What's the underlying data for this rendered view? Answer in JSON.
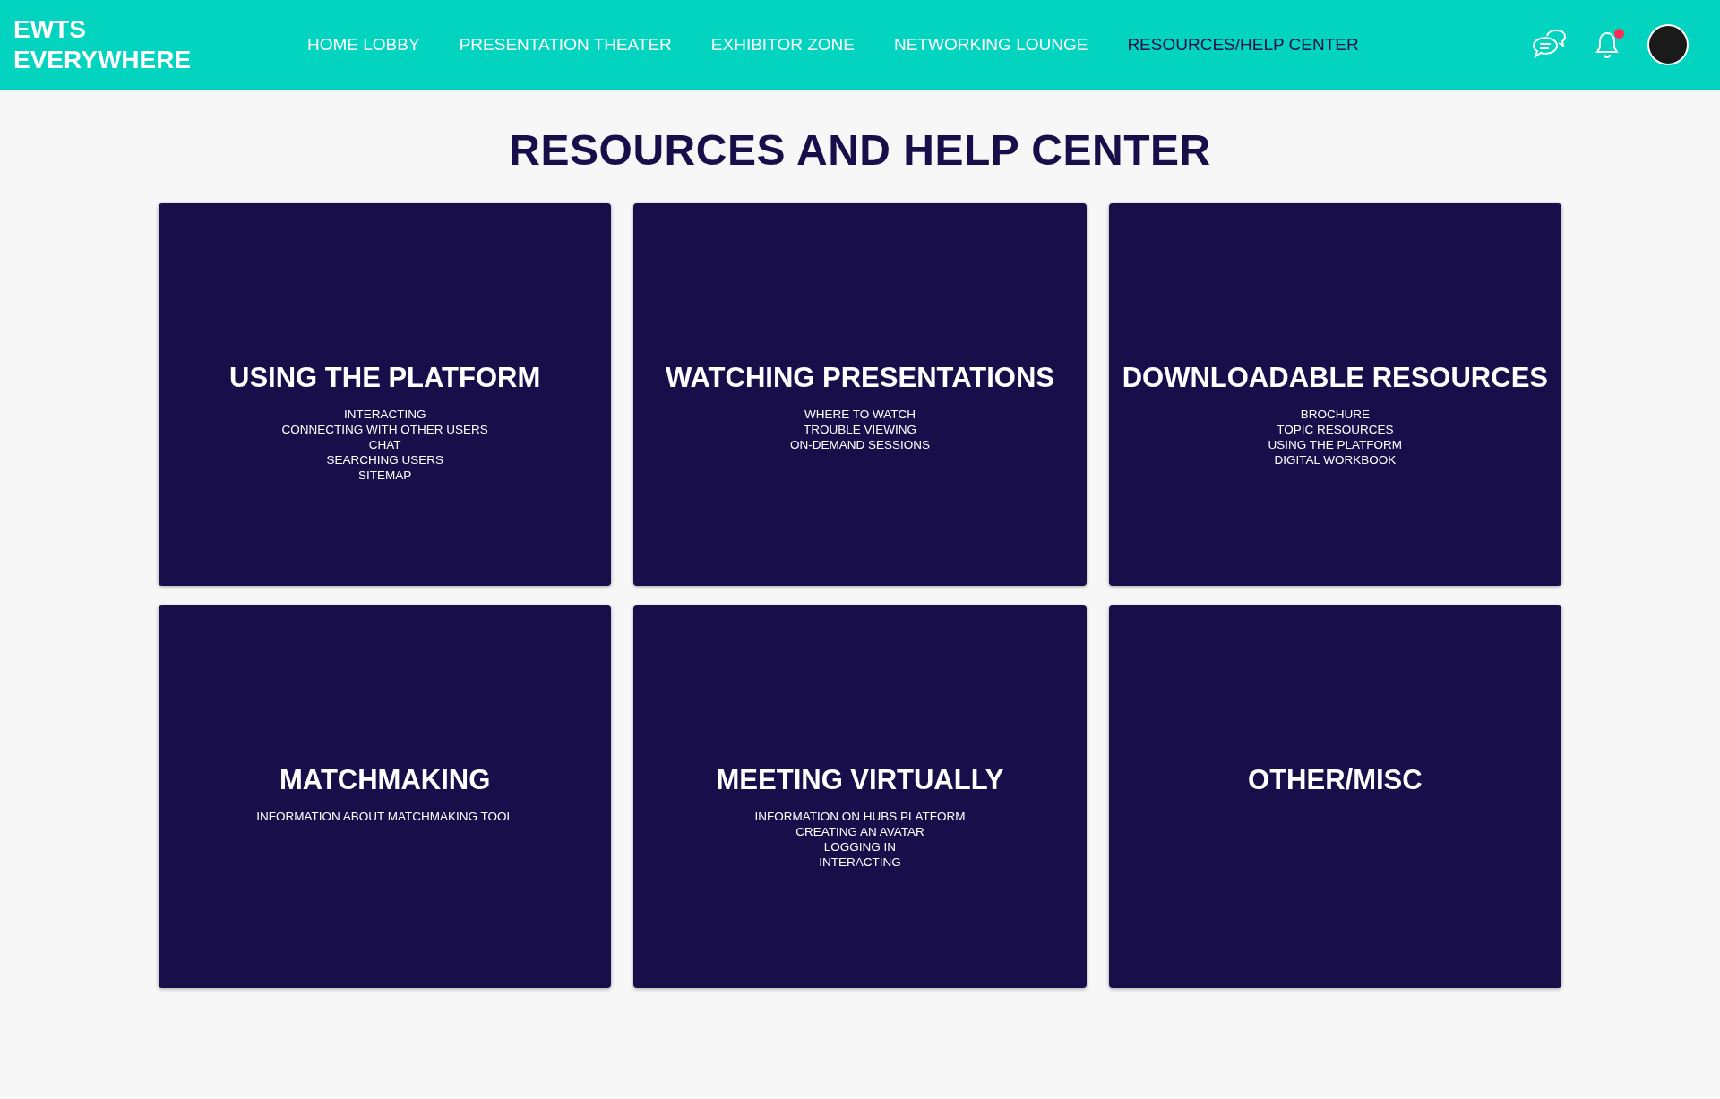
{
  "logo": [
    "EWTS",
    "EVERYWHERE"
  ],
  "nav": [
    {
      "label": "HOME LOBBY",
      "selected": false
    },
    {
      "label": "PRESENTATION THEATER",
      "selected": false
    },
    {
      "label": "EXHIBITOR ZONE",
      "selected": false
    },
    {
      "label": "NETWORKING LOUNGE",
      "selected": false
    },
    {
      "label": "RESOURCES/HELP CENTER",
      "selected": true
    }
  ],
  "notifications": {
    "unread": true
  },
  "heading": "RESOURCES AND HELP CENTER",
  "cards": [
    {
      "title": "USING THE PLATFORM",
      "items": [
        "INTERACTING",
        "CONNECTING WITH OTHER USERS",
        "CHAT",
        "SEARCHING USERS",
        "SITEMAP"
      ]
    },
    {
      "title": "WATCHING PRESENTATIONS",
      "items": [
        "WHERE TO WATCH",
        "TROUBLE VIEWING",
        "ON-DEMAND SESSIONS"
      ]
    },
    {
      "title": "DOWNLOADABLE RESOURCES",
      "items": [
        "BROCHURE",
        "TOPIC RESOURCES",
        "USING THE PLATFORM",
        "DIGITAL WORKBOOK"
      ]
    },
    {
      "title": "MATCHMAKING",
      "items": [
        "INFORMATION ABOUT MATCHMAKING TOOL"
      ]
    },
    {
      "title": "MEETING VIRTUALLY",
      "items": [
        "INFORMATION ON HUBS PLATFORM",
        "CREATING AN AVATAR",
        "LOGGING IN",
        "INTERACTING"
      ]
    },
    {
      "title": "OTHER/MISC"
    }
  ]
}
